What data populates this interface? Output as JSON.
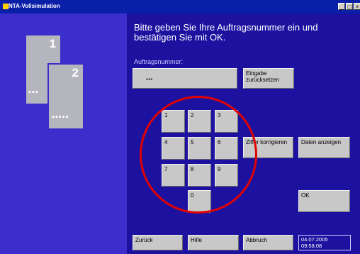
{
  "window": {
    "title": "NTA-Vollsimulation",
    "controls": [
      "_",
      "□",
      "×"
    ]
  },
  "prompt": {
    "text": "Bitte geben Sie Ihre Auftragsnummer ein und bestätigen Sie mit OK."
  },
  "field": {
    "label": "Auftragsnummer:",
    "value": "***"
  },
  "buttons": {
    "reset": "Eingabe zurücksetzen",
    "correct": "Ziffer korrigieren",
    "show": "Daten anzeigen",
    "ok": "OK",
    "back": "Zurück",
    "help": "Hilfe",
    "cancel": "Abbruch"
  },
  "keypad": [
    "1",
    "2",
    "3",
    "4",
    "5",
    "6",
    "7",
    "8",
    "9",
    "0"
  ],
  "cards": [
    {
      "number": "1",
      "dots": "▪▪▪"
    },
    {
      "number": "2",
      "dots": "▪▪▪▪▪"
    }
  ],
  "datetime": {
    "date": "04.07.2005",
    "time": "09:58:08"
  },
  "colors": {
    "titlebar": "#0a1fa8",
    "sidebar": "#3b2ecc",
    "main": "#1d129f",
    "button": "#c8c8c8",
    "highlight": "#e00000"
  }
}
